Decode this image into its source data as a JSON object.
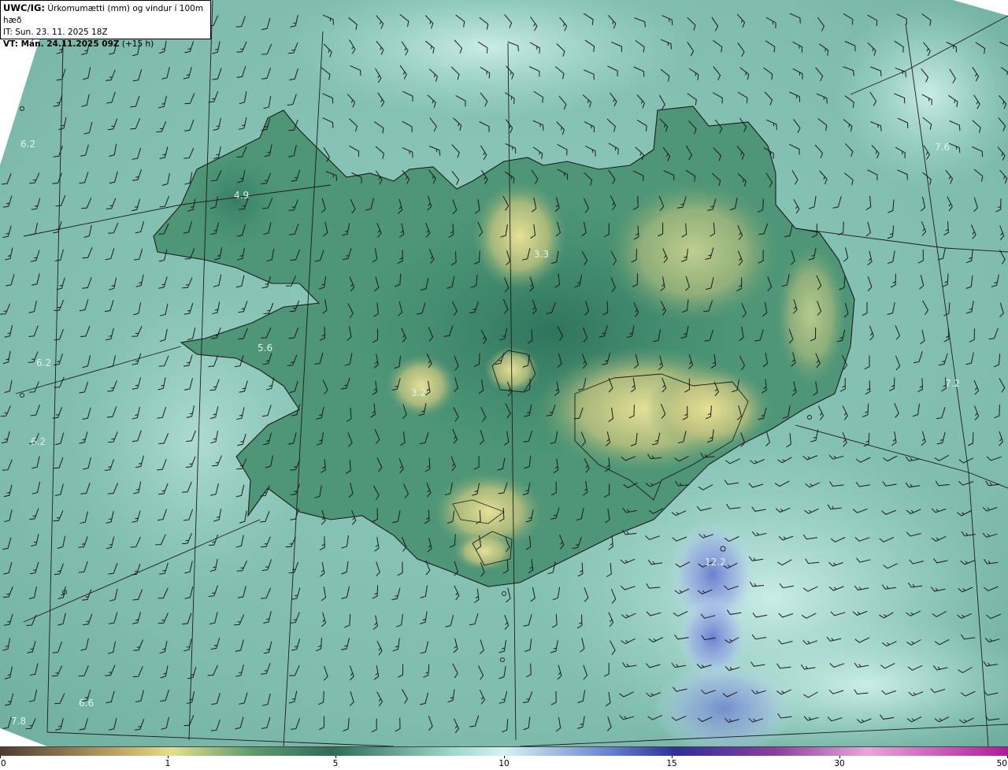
{
  "header": {
    "model": "UWC/IG:",
    "title_rest": " Úrkomumætti (mm) og vindur í 100m hæð",
    "issue_time": "IT: Sun. 23. 11. 2025 18Z",
    "valid_label": "VT: Mán. 24.11.2025 09Z",
    "valid_lead": " (+15 h)"
  },
  "map_labels": [
    {
      "text": "6.2"
    },
    {
      "text": "4.9"
    },
    {
      "text": "5.6"
    },
    {
      "text": "6.2"
    },
    {
      "text": "6.2"
    },
    {
      "text": "3.2"
    },
    {
      "text": "3.3"
    },
    {
      "text": "7.6"
    },
    {
      "text": "7.2"
    },
    {
      "text": "12.2"
    },
    {
      "text": "6.6"
    },
    {
      "text": "7.8"
    }
  ],
  "colorbar": {
    "ticks": [
      "0",
      "1",
      "5",
      "10",
      "15",
      "30",
      "50"
    ],
    "colors": {
      "c0": "#4e3a33",
      "c1": "#c8b26b",
      "c2": "#e2e08a",
      "c3": "#5f9a6e",
      "c4": "#2e6b58",
      "c5": "#9fd8cc",
      "c6": "#d7f2f2",
      "c7": "#6d86d4",
      "c8": "#2d2f98",
      "c9": "#8c3fa0",
      "c10": "#e8a6d8",
      "c11": "#b01a9a"
    }
  },
  "map_colors": {
    "ocean": "#86c2b5",
    "ocean_light": "#b8e6de",
    "land_green": "#3f8a6c",
    "land_yellow": "#d8d68a",
    "rain_blue": "#7d93d6",
    "coast": "#1b1b1b"
  }
}
